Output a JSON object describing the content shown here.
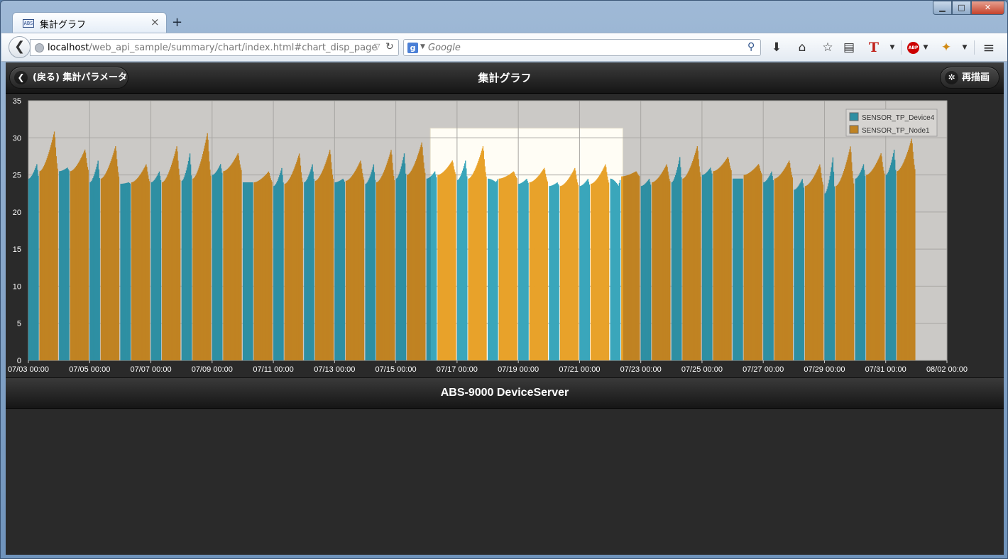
{
  "browser": {
    "tab_title": "集計グラフ",
    "tab_favicon": "ABS",
    "tab_close": "×",
    "new_tab": "+",
    "url_host": "localhost",
    "url_path": "/web_api_sample/summary/chart/index.html#chart_disp_page",
    "search_engine_glyph": "g",
    "search_placeholder": "Google",
    "icons": [
      "back-arrow-icon",
      "globe-icon",
      "reload-icon",
      "google-icon",
      "search-icon",
      "download-icon",
      "home-icon",
      "star-icon",
      "reading-list-icon",
      "t-extension-icon",
      "adblock-icon",
      "extension-icon",
      "menu-icon"
    ]
  },
  "header": {
    "back_label": "(戻る) 集計パラメータ",
    "title": "集計グラフ",
    "redraw_label": "再描画"
  },
  "footer": {
    "text": "ABS-9000 DeviceServer"
  },
  "colors": {
    "device4": "#2e8fa3",
    "node1": "#c08322",
    "node1_highlight": "#e8a22a",
    "device4_highlight": "#3aa6bb",
    "plot_bg": "#cbc9c6",
    "selection_bg": "#fffdf5"
  },
  "chart_data": {
    "type": "bar",
    "title": "",
    "xlabel": "",
    "ylabel": "",
    "ylim": [
      0,
      35
    ],
    "yticks": [
      0,
      5,
      10,
      15,
      20,
      25,
      30,
      35
    ],
    "xlim": [
      "07/03 00:00",
      "08/02 00:00"
    ],
    "xticks": [
      "07/03 00:00",
      "07/05 00:00",
      "07/07 00:00",
      "07/09 00:00",
      "07/11 00:00",
      "07/13 00:00",
      "07/15 00:00",
      "07/17 00:00",
      "07/19 00:00",
      "07/21 00:00",
      "07/23 00:00",
      "07/25 00:00",
      "07/27 00:00",
      "07/29 00:00",
      "07/31 00:00",
      "08/02 00:00"
    ],
    "grid": true,
    "legend_position": "top-right",
    "highlight_range": [
      "07/16 03:00",
      "07/22 10:00"
    ],
    "highlight_peak": 31.3,
    "series": [
      {
        "name": "SENSOR_TP_Device4",
        "x": [
          "07/03",
          "07/04",
          "07/05",
          "07/06",
          "07/07",
          "07/08",
          "07/09",
          "07/10",
          "07/11",
          "07/12",
          "07/13",
          "07/14",
          "07/15",
          "07/16",
          "07/17",
          "07/18",
          "07/19",
          "07/20",
          "07/21",
          "07/22",
          "07/23",
          "07/24",
          "07/25",
          "07/26",
          "07/27",
          "07/28",
          "07/29",
          "07/30",
          "07/31"
        ],
        "low": [
          24.5,
          25.5,
          24.0,
          23.8,
          24.0,
          24.2,
          25.0,
          24.0,
          23.5,
          24.0,
          24.0,
          23.8,
          24.5,
          24.5,
          24.3,
          24.5,
          23.8,
          23.5,
          23.5,
          24.5,
          23.5,
          24.0,
          25.0,
          24.5,
          24.0,
          23.0,
          22.5,
          24.5,
          25.0
        ],
        "peak": [
          28.0,
          27.5,
          28.5,
          25.5,
          27.0,
          29.5,
          28.0,
          25.5,
          27.5,
          28.0,
          26.0,
          28.0,
          29.5,
          27.0,
          28.5,
          25.5,
          26.0,
          25.5,
          26.0,
          25.0,
          26.0,
          29.0,
          27.5,
          26.0,
          27.0,
          26.0,
          29.0,
          28.0,
          30.0
        ]
      },
      {
        "name": "SENSOR_TP_Node1",
        "x": [
          "07/03",
          "07/04",
          "07/05",
          "07/06",
          "07/07",
          "07/08",
          "07/09",
          "07/10",
          "07/11",
          "07/12",
          "07/13",
          "07/14",
          "07/15",
          "07/16",
          "07/17",
          "07/18",
          "07/19",
          "07/20",
          "07/21",
          "07/22",
          "07/23",
          "07/24",
          "07/25",
          "07/26",
          "07/27",
          "07/28",
          "07/29",
          "07/30",
          "07/31"
        ],
        "low": [
          25.5,
          25.5,
          24.5,
          24.0,
          24.0,
          24.5,
          25.5,
          24.0,
          23.8,
          24.2,
          24.2,
          24.0,
          25.0,
          25.0,
          24.5,
          24.5,
          24.0,
          23.5,
          23.8,
          24.8,
          24.0,
          24.5,
          25.5,
          25.0,
          24.5,
          23.5,
          23.5,
          25.0,
          25.5
        ],
        "peak": [
          31.0,
          28.5,
          29.0,
          26.5,
          29.0,
          30.8,
          28.0,
          25.5,
          28.0,
          28.5,
          27.0,
          28.5,
          29.5,
          27.0,
          29.0,
          25.5,
          26.0,
          26.0,
          26.5,
          25.5,
          26.5,
          29.0,
          27.5,
          26.5,
          27.0,
          26.5,
          29.0,
          28.0,
          30.0
        ]
      }
    ]
  }
}
